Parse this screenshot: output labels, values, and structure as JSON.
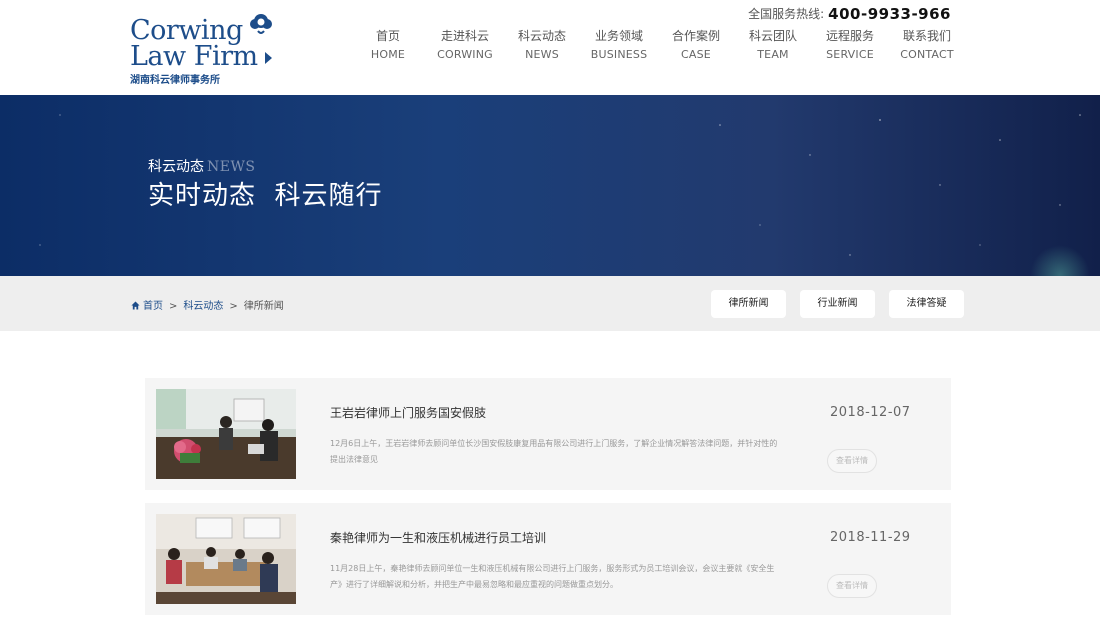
{
  "header": {
    "logo": {
      "line1": "Corwing",
      "line2": "Law Firm",
      "sub": "湖南科云律师事务所"
    },
    "hotline_label": "全国服务热线:",
    "hotline_number": "400-9933-966",
    "nav": [
      {
        "cn": "首页",
        "en": "HOME"
      },
      {
        "cn": "走进科云",
        "en": "CORWING"
      },
      {
        "cn": "科云动态",
        "en": "NEWS"
      },
      {
        "cn": "业务领域",
        "en": "BUSINESS"
      },
      {
        "cn": "合作案例",
        "en": "CASE"
      },
      {
        "cn": "科云团队",
        "en": "TEAM"
      },
      {
        "cn": "远程服务",
        "en": "SERVICE"
      },
      {
        "cn": "联系我们",
        "en": "CONTACT"
      }
    ]
  },
  "banner": {
    "subtitle_cn": "科云动态",
    "subtitle_en": "NEWS",
    "title": "实时动态  科云随行"
  },
  "breadcrumb": {
    "items": [
      "首页",
      "科云动态",
      "律所新闻"
    ],
    "separator": ">"
  },
  "subtabs": [
    "律所新闻",
    "行业新闻",
    "法律答疑"
  ],
  "news": [
    {
      "title": "王岩岩律师上门服务国安假肢",
      "desc": "12月6日上午，王岩岩律师去顾问单位长沙国安假肢康复用品有限公司进行上门服务，了解企业情况解答法律问题，并针对性的提出法律意见",
      "date": "2018-12-07",
      "more": "查看详情"
    },
    {
      "title": "秦艳律师为一生和液压机械进行员工培训",
      "desc": "11月28日上午，秦艳律师去顾问单位一生和液压机械有限公司进行上门服务，服务形式为员工培训会议，会议主要就《安全生产》进行了详细解说和分析，并把生产中最易忽略和最应重视的问题做重点划分。",
      "date": "2018-11-29",
      "more": "查看详情"
    }
  ],
  "colors": {
    "brand": "#1d4d8a",
    "card_bg": "#f5f5f5",
    "crumb_bg": "#eeeeee"
  }
}
